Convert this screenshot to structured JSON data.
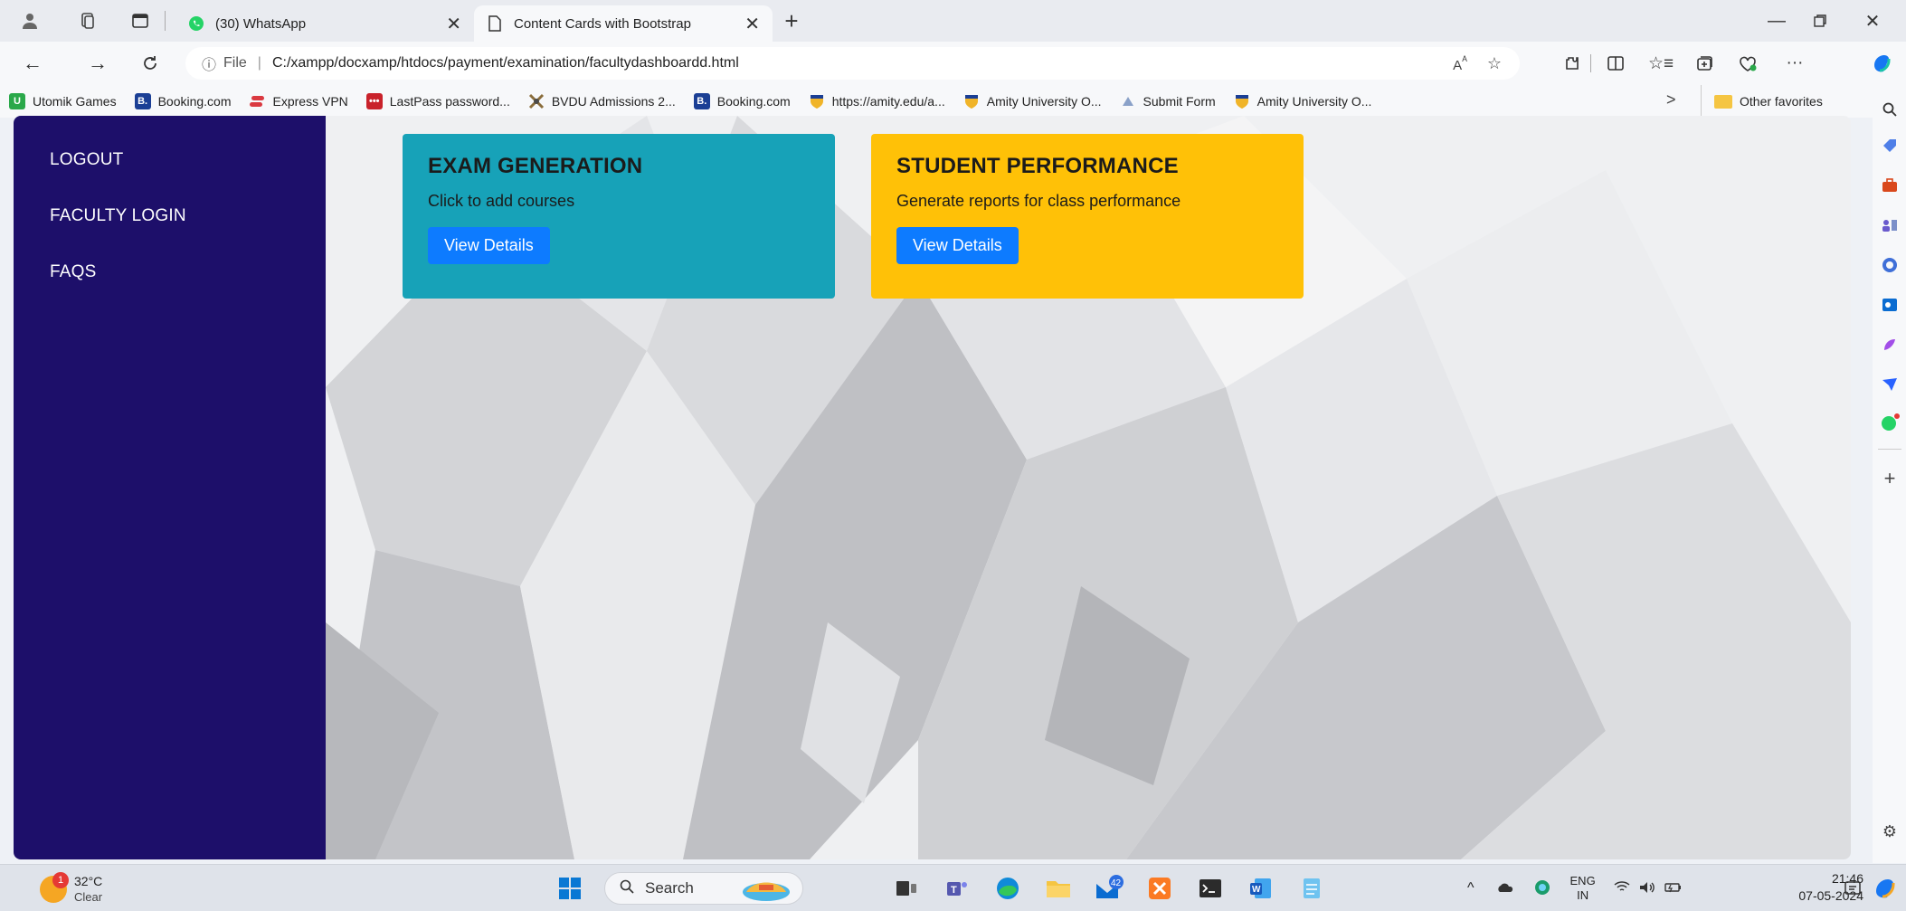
{
  "browser": {
    "tabs": [
      {
        "label": "(30) WhatsApp",
        "active": false
      },
      {
        "label": "Content Cards with Bootstrap",
        "active": true
      }
    ],
    "address": {
      "scheme_label": "File",
      "url": "C:/xampp/docxamp/htdocs/payment/examination/facultydashboardd.html"
    },
    "bookmarks": [
      {
        "label": "Utomik Games",
        "icon_color": "#2aa84a",
        "glyph": "U"
      },
      {
        "label": "Booking.com",
        "icon_color": "#1b3f95",
        "glyph": "B."
      },
      {
        "label": "Express VPN",
        "icon_color": "#da3940",
        "glyph": ""
      },
      {
        "label": "LastPass password...",
        "icon_color": "#c9222b",
        "glyph": "•••"
      },
      {
        "label": "BVDU Admissions 2...",
        "icon_color": "#8a6d3b",
        "glyph": ""
      },
      {
        "label": "Booking.com",
        "icon_color": "#1b3f95",
        "glyph": "B."
      },
      {
        "label": "https://amity.edu/a...",
        "icon_color": "#f0b429",
        "glyph": ""
      },
      {
        "label": "Amity University O...",
        "icon_color": "#f0b429",
        "glyph": ""
      },
      {
        "label": "Submit Form",
        "icon_color": "#8aa1c8",
        "glyph": ""
      },
      {
        "label": "Amity University O...",
        "icon_color": "#f0b429",
        "glyph": ""
      }
    ],
    "bookmarks_overflow": ">",
    "other_favorites": "Other favorites"
  },
  "page": {
    "sidebar": {
      "links": [
        {
          "label": "LOGOUT"
        },
        {
          "label": "FACULTY LOGIN"
        },
        {
          "label": "FAQS"
        }
      ]
    },
    "cards": [
      {
        "title": "EXAM GENERATION",
        "text": "Click to add courses",
        "button": "View Details",
        "color": "#17a2b8"
      },
      {
        "title": "STUDENT PERFORMANCE",
        "text": "Generate reports for class performance",
        "button": "View Details",
        "color": "#ffc107"
      }
    ],
    "sidebar_color": "#1d0f6a"
  },
  "taskbar": {
    "weather": {
      "temp": "32°C",
      "condition": "Clear",
      "alert_count": "1"
    },
    "search_placeholder": "Search",
    "mail_badge": "42",
    "lang_top": "ENG",
    "lang_bottom": "IN",
    "time": "21:46",
    "date": "07-05-2024"
  }
}
